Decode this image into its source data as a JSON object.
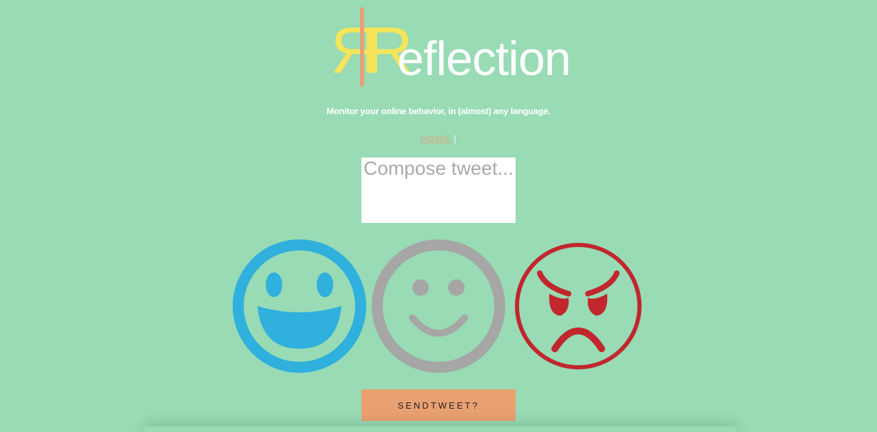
{
  "logo": {
    "mirror_letter": "R",
    "letter": "R",
    "rest": "eflection",
    "colors": {
      "letters": "#f4e55a",
      "divider": "#e9a07a",
      "rest": "#ffffff"
    }
  },
  "tagline": "Monitor your online behavior, in (almost) any language.",
  "nav": {
    "home_label": "HOME",
    "separator": "|"
  },
  "compose": {
    "placeholder": "Compose tweet..."
  },
  "faces": [
    {
      "name": "happy",
      "icon": "happy-face-icon",
      "color": "#2fb0dd"
    },
    {
      "name": "neutral",
      "icon": "smile-face-icon",
      "color": "#a6a6a6"
    },
    {
      "name": "angry",
      "icon": "angry-face-icon",
      "color": "#c1272d"
    }
  ],
  "send_button": {
    "label": "SENDTWEET?"
  },
  "colors": {
    "background": "#98dbb5",
    "accent": "#e9a071"
  }
}
